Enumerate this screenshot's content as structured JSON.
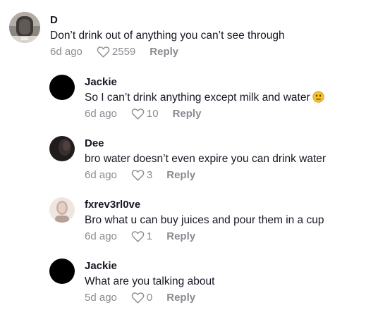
{
  "comments": [
    {
      "username": "D",
      "text": "Don’t drink out of anything you can’t see through",
      "time": "6d ago",
      "likes": "2559",
      "reply_label": "Reply",
      "avatar": "photo-avatar-gray"
    },
    {
      "username": "Jackie",
      "text": "So I can’t drink anything except milk and water",
      "emoji": "neutral-face-emoji",
      "time": "6d ago",
      "likes": "10",
      "reply_label": "Reply",
      "avatar": "black-avatar"
    },
    {
      "username": "Dee",
      "text": "bro water doesn’t even expire you can drink water",
      "time": "6d ago",
      "likes": "3",
      "reply_label": "Reply",
      "avatar": "dark-photo-avatar"
    },
    {
      "username": "fxrev3rl0ve",
      "text": "Bro what u can buy juices and pour them in a cup",
      "time": "6d ago",
      "likes": "1",
      "reply_label": "Reply",
      "avatar": "light-photo-avatar"
    },
    {
      "username": "Jackie",
      "text": "What are you talking about",
      "time": "5d ago",
      "likes": "0",
      "reply_label": "Reply",
      "avatar": "black-avatar"
    }
  ],
  "colors": {
    "text": "#161823",
    "muted": "#8a8b91"
  },
  "icons": {
    "like": "heart-outline-icon"
  }
}
